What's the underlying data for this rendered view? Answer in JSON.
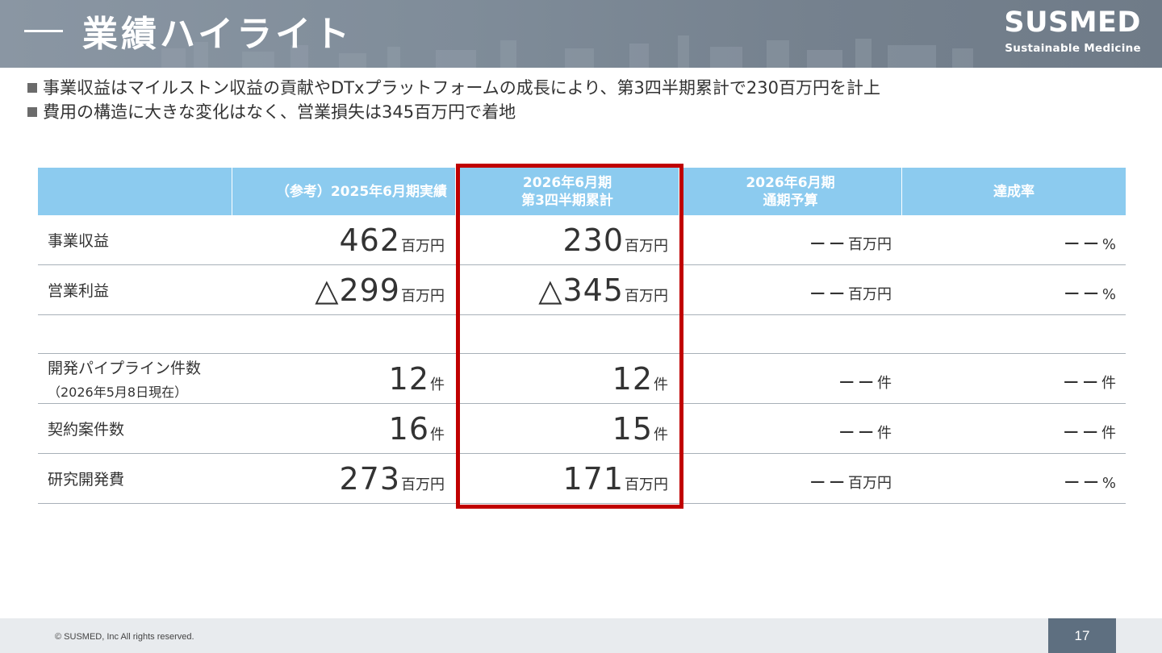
{
  "header": {
    "title": "業績ハイライト",
    "brand_name": "SUSMED",
    "brand_tagline": "Sustainable Medicine"
  },
  "bullets": [
    "事業収益はマイルストン収益の貢献やDTxプラットフォームの成長により、第3四半期累計で230百万円を計上",
    "費用の構造に大きな変化はなく、営業損失は345百万円で着地"
  ],
  "table": {
    "columns": [
      "",
      "（参考）2025年6月期実績",
      "2026年6月期\n第3四半期累計",
      "2026年6月期\n通期予算",
      "達成率"
    ],
    "column_lines": [
      [
        ""
      ],
      [
        "（参考）2025年6月期実績"
      ],
      [
        "2026年6月期",
        "第3四半期累計"
      ],
      [
        "2026年6月期",
        "通期予算"
      ],
      [
        "達成率"
      ]
    ],
    "rows": [
      {
        "label": "事業収益",
        "sub": "",
        "values": [
          {
            "num": "462",
            "unit": "百万円"
          },
          {
            "num": "230",
            "unit": "百万円"
          },
          {
            "num": "−−",
            "unit": "百万円"
          },
          {
            "num": "−−",
            "unit": "%"
          }
        ]
      },
      {
        "label": "営業利益",
        "sub": "",
        "values": [
          {
            "num": "△299",
            "unit": "百万円"
          },
          {
            "num": "△345",
            "unit": "百万円"
          },
          {
            "num": "−−",
            "unit": "百万円"
          },
          {
            "num": "−−",
            "unit": "%"
          }
        ]
      },
      {
        "label": "開発パイプライン件数",
        "sub": "（2026年5月8日現在）",
        "values": [
          {
            "num": "12",
            "unit": "件"
          },
          {
            "num": "12",
            "unit": "件"
          },
          {
            "num": "−−",
            "unit": "件"
          },
          {
            "num": "−−",
            "unit": "件"
          }
        ]
      },
      {
        "label": "契約案件数",
        "sub": "",
        "values": [
          {
            "num": "16",
            "unit": "件"
          },
          {
            "num": "15",
            "unit": "件"
          },
          {
            "num": "−−",
            "unit": "件"
          },
          {
            "num": "−−",
            "unit": "件"
          }
        ]
      },
      {
        "label": "研究開発費",
        "sub": "",
        "values": [
          {
            "num": "273",
            "unit": "百万円"
          },
          {
            "num": "171",
            "unit": "百万円"
          },
          {
            "num": "−−",
            "unit": "百万円"
          },
          {
            "num": "−−",
            "unit": "%"
          }
        ]
      }
    ]
  },
  "footer": {
    "copyright": "© SUSMED, Inc All rights reserved.",
    "page_number": "17"
  },
  "colors": {
    "header_bg": "#7f8c99",
    "table_head": "#8ccbef",
    "highlight_border": "#c00000",
    "page_badge": "#5e6f80",
    "footer_bg": "#e8ebee"
  }
}
